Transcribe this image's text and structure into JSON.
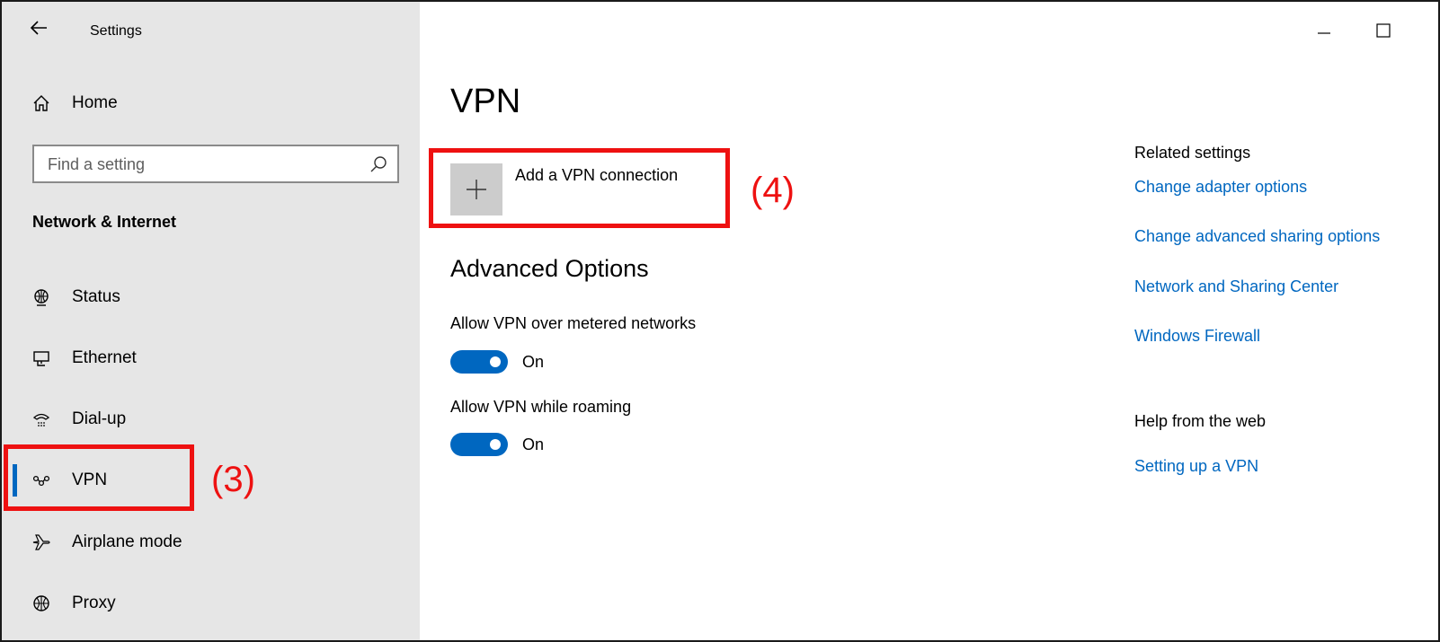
{
  "window": {
    "title": "Settings",
    "back_icon": "arrow-left-icon",
    "minimize_icon": "minimize-icon",
    "maximize_icon": "maximize-icon"
  },
  "sidebar": {
    "home": {
      "label": "Home",
      "icon": "home-icon"
    },
    "search": {
      "placeholder": "Find a setting",
      "icon": "search-icon"
    },
    "section_title": "Network & Internet",
    "items": [
      {
        "label": "Status",
        "icon": "globe-status-icon",
        "selected": false
      },
      {
        "label": "Ethernet",
        "icon": "ethernet-monitor-icon",
        "selected": false
      },
      {
        "label": "Dial-up",
        "icon": "dialup-phone-icon",
        "selected": false
      },
      {
        "label": "VPN",
        "icon": "vpn-icon",
        "selected": true
      },
      {
        "label": "Airplane mode",
        "icon": "airplane-icon",
        "selected": false
      },
      {
        "label": "Proxy",
        "icon": "proxy-globe-icon",
        "selected": false
      }
    ]
  },
  "main": {
    "title": "VPN",
    "add_vpn": {
      "label": "Add a VPN connection",
      "icon": "plus-icon"
    },
    "advanced": {
      "title": "Advanced Options",
      "options": [
        {
          "label": "Allow VPN over metered networks",
          "state": "On",
          "on": true
        },
        {
          "label": "Allow VPN while roaming",
          "state": "On",
          "on": true
        }
      ]
    }
  },
  "related": {
    "heading": "Related settings",
    "links": [
      "Change adapter options",
      "Change advanced sharing options",
      "Network and Sharing Center",
      "Windows Firewall"
    ],
    "help_heading": "Help from the web",
    "help_links": [
      "Setting up a VPN"
    ]
  },
  "annotations": {
    "step3": "(3)",
    "step4": "(4)",
    "color": "#ee1111"
  },
  "colors": {
    "accent": "#0067c0",
    "sidebar_bg": "#e6e6e6",
    "plus_tile": "#cccccc"
  }
}
